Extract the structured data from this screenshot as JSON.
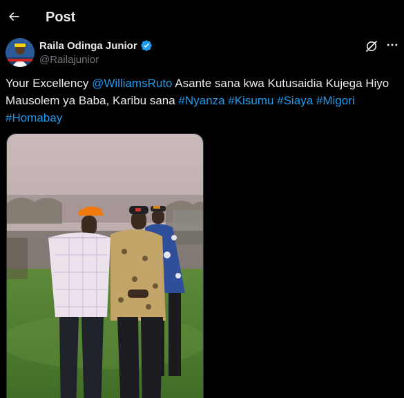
{
  "header": {
    "title": "Post",
    "back_icon": "arrow-left-icon"
  },
  "author": {
    "name": "Raila Odinga Junior",
    "handle": "@Railajunior",
    "verified": true,
    "verified_color": "#1d9bf0"
  },
  "tweet": {
    "parts": [
      {
        "text": "Your Excellency ",
        "link": false
      },
      {
        "text": "@WilliamsRuto",
        "link": true
      },
      {
        "text": "  Asante sana kwa Kutusaidia  Kujega Hiyo Mausolem ya Baba, Karibu sana ",
        "link": false
      },
      {
        "text": "#Nyanza",
        "link": true
      },
      {
        "text": " ",
        "link": false
      },
      {
        "text": "#Kisumu",
        "link": true
      },
      {
        "text": " ",
        "link": false
      },
      {
        "text": "#Siaya",
        "link": true
      },
      {
        "text": " ",
        "link": false
      },
      {
        "text": "#Migori",
        "link": true
      },
      {
        "text": " ",
        "link": false
      },
      {
        "text": "#Homabay",
        "link": true
      }
    ]
  },
  "media": {
    "alt_icon": "photo-icon"
  },
  "colors": {
    "accent": "#1d9bf0",
    "text": "#e7e9ea",
    "muted": "#71767b",
    "bg": "#000000"
  }
}
